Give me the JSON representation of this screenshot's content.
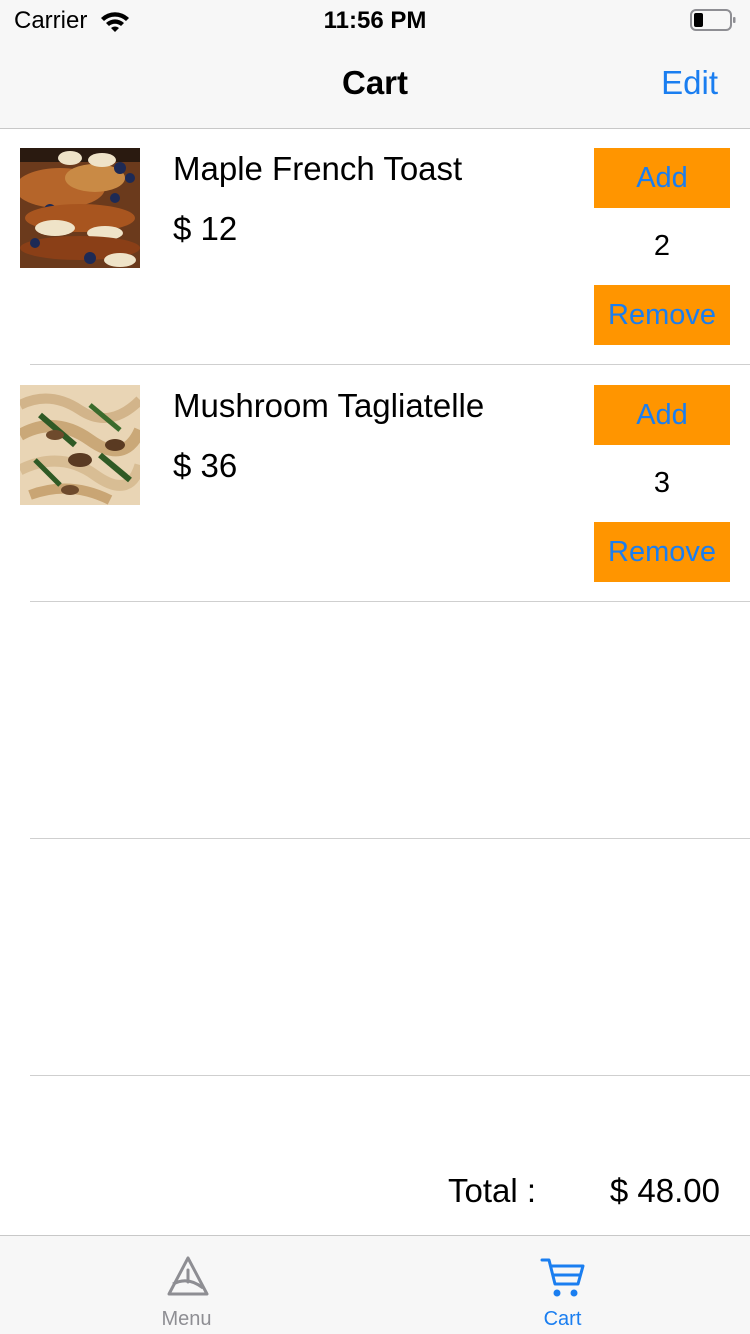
{
  "status_bar": {
    "carrier": "Carrier",
    "time": "11:56 PM"
  },
  "nav": {
    "title": "Cart",
    "edit_label": "Edit"
  },
  "cart": {
    "items": [
      {
        "name": "Maple French Toast",
        "price": "$ 12",
        "quantity": "2",
        "add_label": "Add",
        "remove_label": "Remove",
        "image": "french-toast-photo"
      },
      {
        "name": "Mushroom Tagliatelle",
        "price": "$ 36",
        "quantity": "3",
        "add_label": "Add",
        "remove_label": "Remove",
        "image": "tagliatelle-photo"
      }
    ],
    "total_label": "Total :",
    "total_value": "$ 48.00"
  },
  "tab_bar": {
    "tabs": [
      {
        "label": "Menu",
        "icon": "menu-icon",
        "selected": false
      },
      {
        "label": "Cart",
        "icon": "cart-icon",
        "selected": true
      }
    ]
  },
  "colors": {
    "accent": "#1a7ef0",
    "button_bg": "#ff9500",
    "inactive": "#8e8e93"
  }
}
